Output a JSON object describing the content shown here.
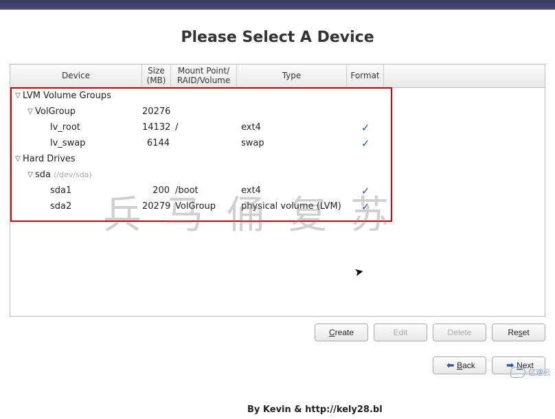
{
  "title": "Please Select A Device",
  "columns": {
    "device": "Device",
    "size": "Size (MB)",
    "mount": "Mount Point/ RAID/Volume",
    "type": "Type",
    "format": "Format"
  },
  "groups": {
    "lvm": {
      "label": "LVM Volume Groups",
      "volgroup": {
        "name": "VolGroup",
        "size": "20276"
      },
      "lvs": [
        {
          "name": "lv_root",
          "size": "14132",
          "mount": "/",
          "type": "ext4",
          "format": "✓"
        },
        {
          "name": "lv_swap",
          "size": "6144",
          "mount": "",
          "type": "swap",
          "format": "✓"
        }
      ]
    },
    "hd": {
      "label": "Hard Drives",
      "disk": {
        "name": "sda",
        "path": "(/dev/sda)"
      },
      "parts": [
        {
          "name": "sda1",
          "size": "200",
          "mount": "/boot",
          "type": "ext4",
          "format": "✓"
        },
        {
          "name": "sda2",
          "size": "20279",
          "mount": "VolGroup",
          "type": "physical volume (LVM)",
          "format": "✓"
        }
      ]
    }
  },
  "buttons": {
    "create_pre": "C",
    "create_post": "reate",
    "edit": "Edit",
    "delete": "Delete",
    "reset_pre": "Re",
    "reset_post": "et",
    "reset_u": "s",
    "back_pre": "",
    "back_u": "B",
    "back_post": "ack",
    "next_pre": "",
    "next_u": "N",
    "next_post": "ext"
  },
  "watermark": "兵马俑复苏",
  "credit": "By Kevin & http://kely28.bl",
  "brand": "亿速云"
}
